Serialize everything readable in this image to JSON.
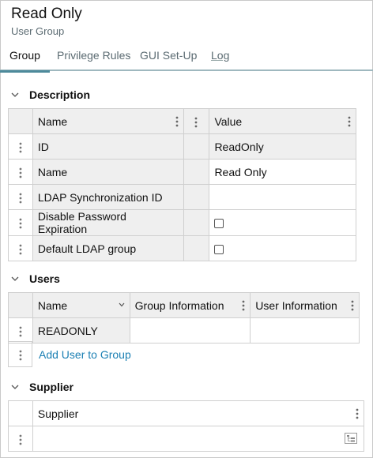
{
  "header": {
    "title": "Read Only",
    "subtitle": "User Group"
  },
  "tabs": [
    {
      "label": "Group",
      "active": true
    },
    {
      "label": "Privilege Rules",
      "active": false
    },
    {
      "label": "GUI Set-Up",
      "active": false
    },
    {
      "label": "Log",
      "active": false
    }
  ],
  "description": {
    "title": "Description",
    "columns": {
      "name": "Name",
      "value": "Value"
    },
    "rows": [
      {
        "name": "ID",
        "value": "ReadOnly"
      },
      {
        "name": "Name",
        "value": "Read Only"
      },
      {
        "name": "LDAP Synchronization ID",
        "value": ""
      },
      {
        "name": "Disable Password Expiration",
        "checked": false
      },
      {
        "name": "Default LDAP group",
        "checked": false
      }
    ]
  },
  "users": {
    "title": "Users",
    "columns": {
      "name": "Name",
      "group_info": "Group Information",
      "user_info": "User Information"
    },
    "rows": [
      {
        "name": "READONLY",
        "group_info": "",
        "user_info": ""
      }
    ],
    "add_link": "Add User to Group"
  },
  "supplier": {
    "title": "Supplier",
    "columns": {
      "supplier": "Supplier"
    },
    "rows": [
      {
        "supplier": ""
      }
    ]
  },
  "colors": {
    "accent": "#4d8a9b",
    "link": "#1a7fb3",
    "grid_header_bg": "#efefef",
    "border": "#cfcfcf"
  }
}
